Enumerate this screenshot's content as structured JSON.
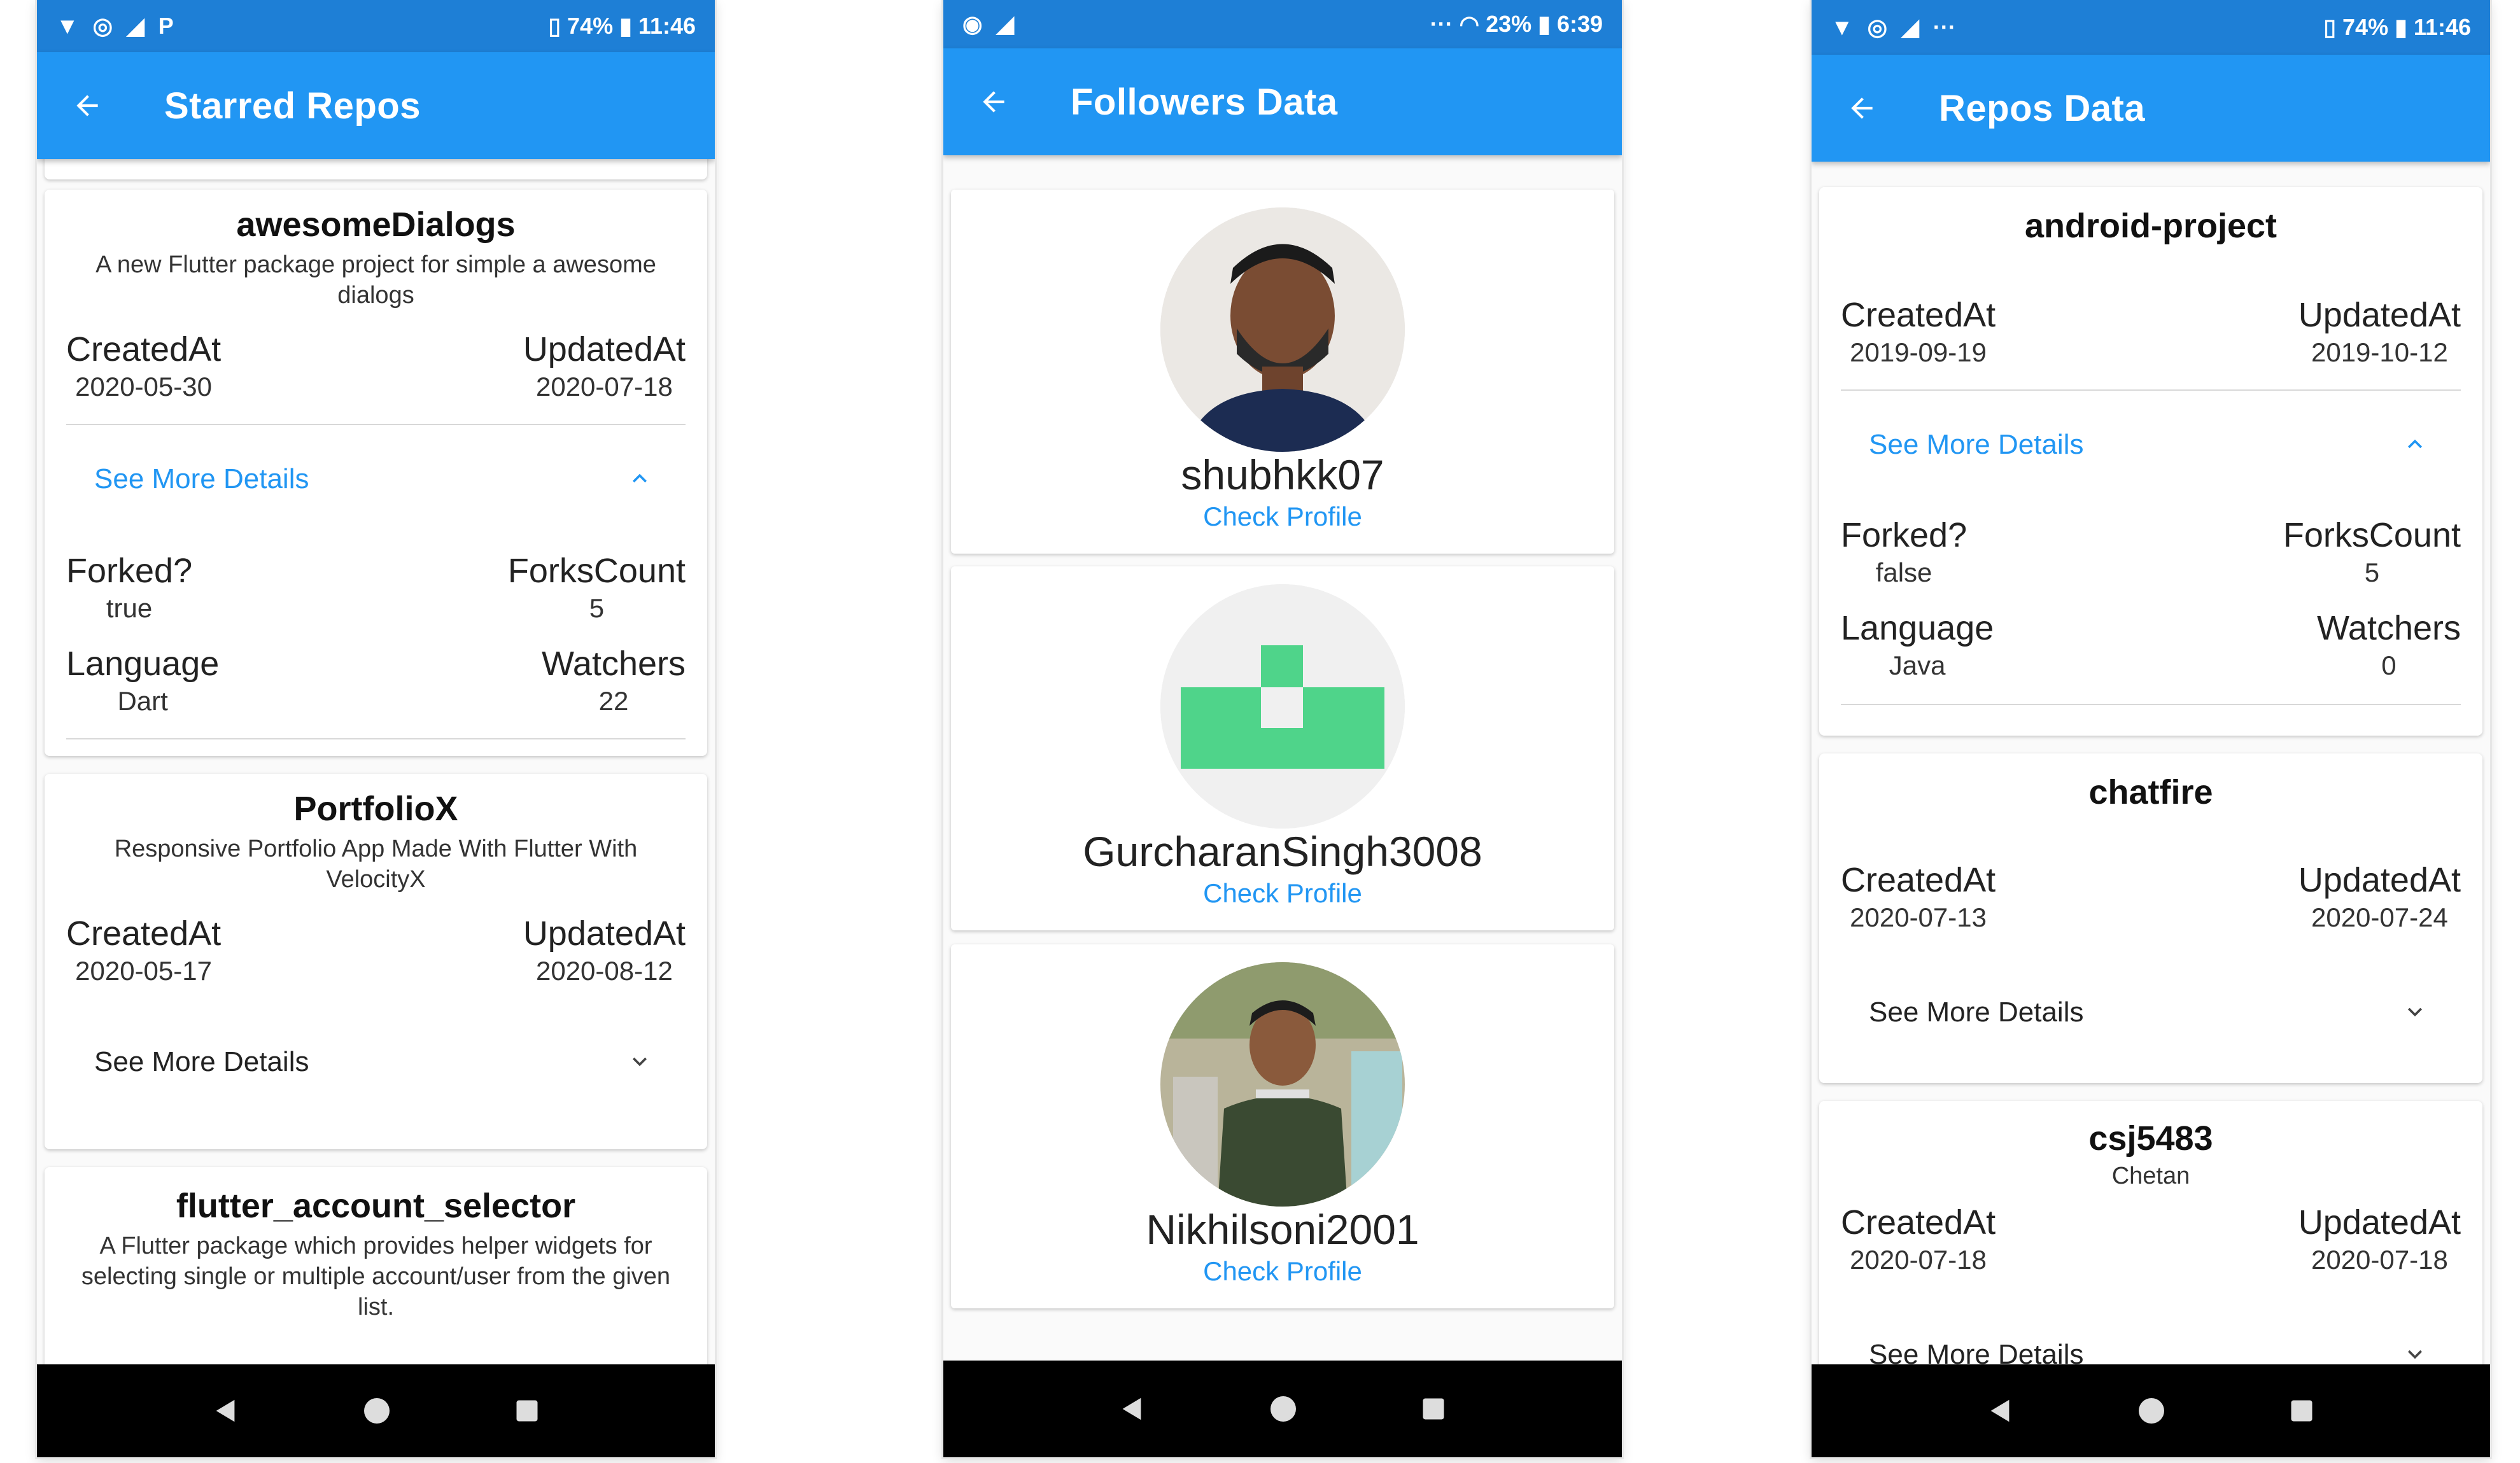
{
  "colors": {
    "primary": "#2196f3",
    "status": "#1e7fd6",
    "link": "#2196f3"
  },
  "phone1": {
    "status": {
      "battery": "74%",
      "time": "11:46"
    },
    "title": "Starred Repos",
    "repos": [
      {
        "name": "awesomeDialogs",
        "desc": "A new Flutter package project for simple a awesome dialogs",
        "created_label": "CreatedAt",
        "created": "2020-05-30",
        "updated_label": "UpdatedAt",
        "updated": "2020-07-18",
        "see_more": "See More Details",
        "forked_label": "Forked?",
        "forked": "true",
        "forks_label": "ForksCount",
        "forks": "5",
        "language_label": "Language",
        "language": "Dart",
        "watchers_label": "Watchers",
        "watchers": "22"
      },
      {
        "name": "PortfolioX",
        "desc": "Responsive Portfolio App Made With Flutter With VelocityX",
        "created_label": "CreatedAt",
        "created": "2020-05-17",
        "updated_label": "UpdatedAt",
        "updated": "2020-08-12",
        "see_more": "See More Details"
      },
      {
        "name": "flutter_account_selector",
        "desc": "A Flutter package which provides helper widgets for selecting single or multiple account/user from the given list."
      }
    ]
  },
  "phone2": {
    "status": {
      "battery": "23%",
      "time": "6:39"
    },
    "title": "Followers Data",
    "followers": [
      {
        "name": "shubhkk07",
        "link": "Check Profile"
      },
      {
        "name": "GurcharanSingh3008",
        "link": "Check Profile"
      },
      {
        "name": "Nikhilsoni2001",
        "link": "Check Profile"
      }
    ]
  },
  "phone3": {
    "status": {
      "battery": "74%",
      "time": "11:46"
    },
    "title": "Repos Data",
    "repos": [
      {
        "name": "android-project",
        "created_label": "CreatedAt",
        "created": "2019-09-19",
        "updated_label": "UpdatedAt",
        "updated": "2019-10-12",
        "see_more": "See More Details",
        "forked_label": "Forked?",
        "forked": "false",
        "forks_label": "ForksCount",
        "forks": "5",
        "language_label": "Language",
        "language": "Java",
        "watchers_label": "Watchers",
        "watchers": "0"
      },
      {
        "name": "chatfire",
        "created_label": "CreatedAt",
        "created": "2020-07-13",
        "updated_label": "UpdatedAt",
        "updated": "2020-07-24",
        "see_more": "See More Details"
      },
      {
        "name": "csj5483",
        "desc": "Chetan",
        "created_label": "CreatedAt",
        "created": "2020-07-18",
        "updated_label": "UpdatedAt",
        "updated": "2020-07-18",
        "see_more": "See More Details"
      }
    ]
  }
}
